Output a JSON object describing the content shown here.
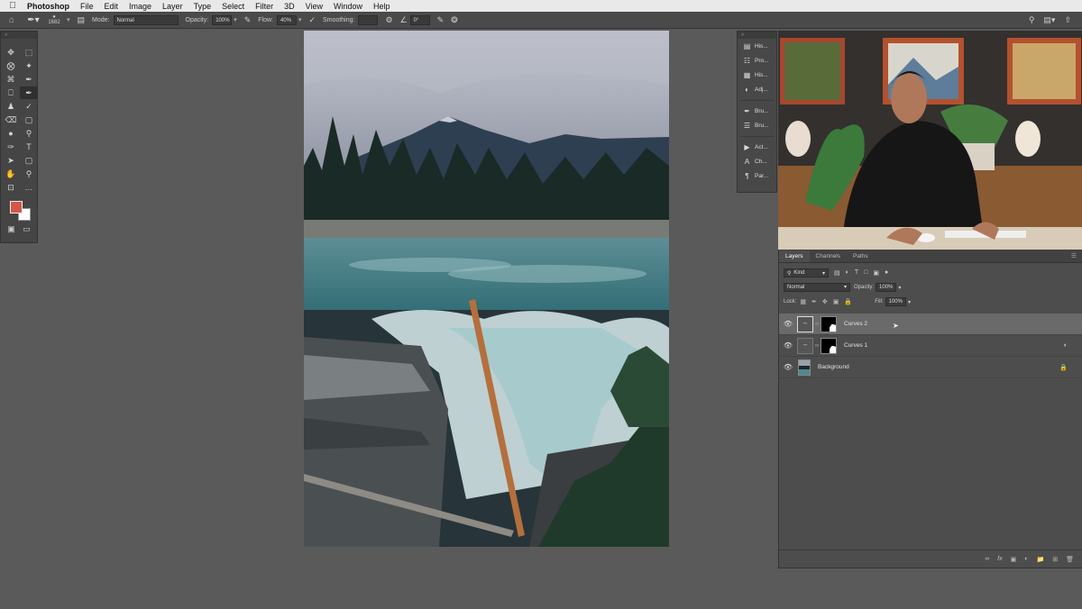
{
  "menubar": {
    "apple_icon": "apple-icon",
    "app": "Photoshop",
    "items": [
      "File",
      "Edit",
      "Image",
      "Layer",
      "Type",
      "Select",
      "Filter",
      "3D",
      "View",
      "Window",
      "Help"
    ]
  },
  "options": {
    "brush_size": "1682",
    "mode_label": "Mode:",
    "mode_value": "Normal",
    "opacity_label": "Opacity:",
    "opacity_value": "100%",
    "flow_label": "Flow:",
    "flow_value": "40%",
    "smoothing_label": "Smoothing:",
    "smoothing_value": "",
    "angle_value": "0°"
  },
  "dock": {
    "items": [
      {
        "label": "His...",
        "icon": "histogram-icon"
      },
      {
        "label": "Pro...",
        "icon": "properties-icon"
      },
      {
        "label": "His...",
        "icon": "history-icon"
      },
      {
        "label": "Adj...",
        "icon": "adjustments-icon"
      },
      {
        "label": "Bru...",
        "icon": "brush-icon"
      },
      {
        "label": "Bru...",
        "icon": "brush-settings-icon"
      },
      {
        "label": "Act...",
        "icon": "actions-icon"
      },
      {
        "label": "Ch...",
        "icon": "character-icon"
      },
      {
        "label": "Par...",
        "icon": "paragraph-icon"
      }
    ]
  },
  "layers_panel": {
    "tabs": [
      "Layers",
      "Channels",
      "Paths"
    ],
    "active_tab": "Layers",
    "filter_kind": "Kind",
    "blend_mode": "Normal",
    "opacity_label": "Opacity:",
    "opacity_value": "100%",
    "lock_label": "Lock:",
    "fill_label": "Fill:",
    "fill_value": "100%",
    "layers": [
      {
        "name": "Curves 2",
        "selected": true,
        "type": "curves"
      },
      {
        "name": "Curves 1",
        "selected": false,
        "type": "curves"
      },
      {
        "name": "Background",
        "selected": false,
        "type": "image",
        "locked": true
      }
    ],
    "bottom_icons": [
      "link-icon",
      "fx-icon",
      "mask-icon",
      "adjustment-layer-icon",
      "group-icon",
      "new-layer-icon",
      "trash-icon"
    ]
  },
  "colors": {
    "foreground": "#d4574a",
    "background": "#ffffff",
    "workspace": "#5a5a5a",
    "panel": "#4d4d4d"
  }
}
